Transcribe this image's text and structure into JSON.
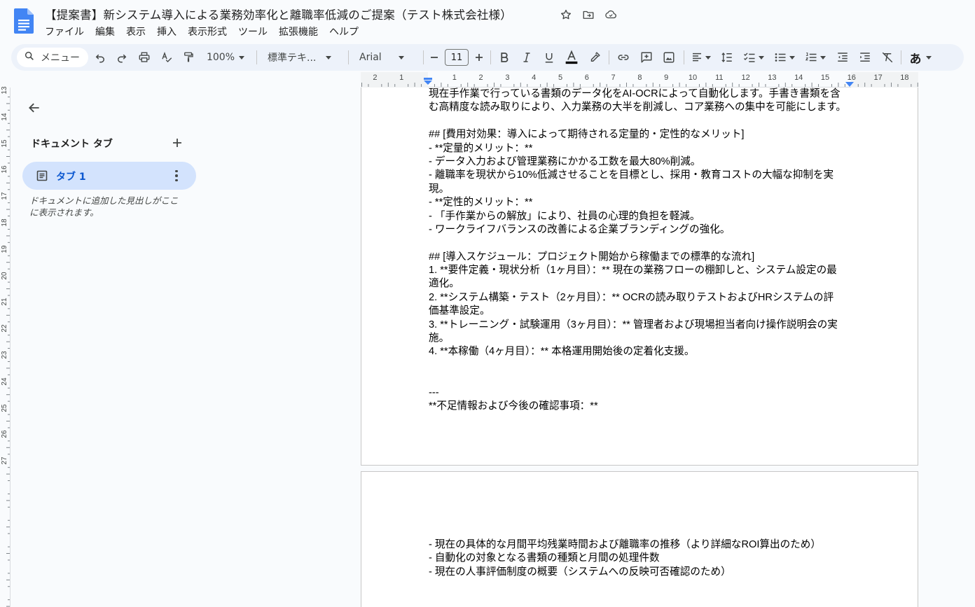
{
  "app": {
    "title": "【提案書】新システム導入による業務効率化と離職率低減のご提案（テスト株式会社様）",
    "accent_color": "#0b57d0",
    "doc_icon": "google-docs-icon"
  },
  "menu": [
    "ファイル",
    "編集",
    "表示",
    "挿入",
    "表示形式",
    "ツール",
    "拡張機能",
    "ヘルプ"
  ],
  "toolbar": {
    "search_label": "メニュー",
    "zoom": "100%",
    "style": "標準テキ...",
    "font": "Arial",
    "font_size": "11",
    "input_mode": "あ"
  },
  "sidebar": {
    "heading": "ドキュメント タブ",
    "tab_label": "タブ 1",
    "hint": "ドキュメントに追加した見出しがここに表示されます。"
  },
  "ruler": {
    "horizontal": [
      "2",
      "1",
      "1",
      "2",
      "3",
      "4",
      "5",
      "6",
      "7",
      "8",
      "9",
      "10",
      "11",
      "12",
      "13",
      "14",
      "15",
      "16",
      "17",
      "18"
    ],
    "vertical": [
      "13",
      "14",
      "15",
      "16",
      "17",
      "18",
      "19",
      "20",
      "21",
      "22",
      "23",
      "24",
      "25",
      "26",
      "27"
    ]
  },
  "page1_lines": [
    " 現在手作業で行っている書類のデータ化をAI-OCRによって自動化します。手書き書類を含",
    "む高精度な読み取りにより、入力業務の大半を削減し、コア業務への集中を可能にします。",
    "",
    "## [費用対効果：導入によって期待される定量的・定性的なメリット]",
    "- **定量的メリット：**",
    "  - データ入力および管理業務にかかる工数を最大80%削減。",
    "  - 離職率を現状から10%低減させることを目標とし、採用・教育コストの大幅な抑制を実",
    "現。",
    "- **定性的メリット：**",
    "  - 「手作業からの解放」により、社員の心理的負担を軽減。",
    "  - ワークライフバランスの改善による企業ブランディングの強化。",
    "",
    "## [導入スケジュール：プロジェクト開始から稼働までの標準的な流れ]",
    "1. **要件定義・現状分析（1ヶ月目）：** 現在の業務フローの棚卸しと、システム設定の最",
    "適化。",
    "2. **システム構築・テスト（2ヶ月目）：** OCRの読み取りテストおよびHRシステムの評",
    "価基準設定。",
    "3. **トレーニング・試験運用（3ヶ月目）：** 管理者および現場担当者向け操作説明会の実",
    "施。",
    "4. **本稼働（4ヶ月目）：** 本格運用開始後の定着化支援。",
    "",
    "",
    "---",
    "**不足情報および今後の確認事項：**"
  ],
  "page2_lines": [
    "- 現在の具体的な月間平均残業時間および離職率の推移（より詳細なROI算出のため）",
    "- 自動化の対象となる書類の種類と月間の処理件数",
    "- 現在の人事評価制度の概要（システムへの反映可否確認のため）"
  ]
}
